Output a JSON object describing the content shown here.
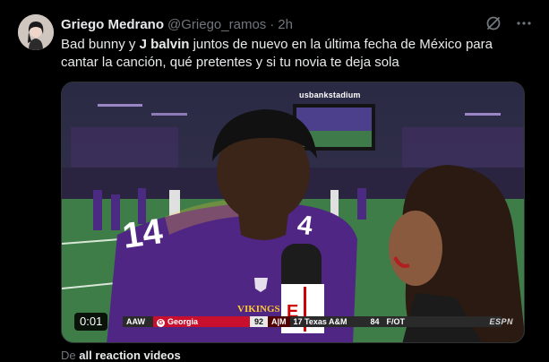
{
  "tweet": {
    "display_name": "Griego Medrano",
    "handle": "@Griego_ramos",
    "separator": "·",
    "time": "2h",
    "text_part1": "Bad bunny y ",
    "text_bold": "J balvin",
    "text_part2": " juntos de nuevo en la última fecha de México para cantar la canción, qué pretentes y si tu novia te deja sola"
  },
  "actions": {
    "grok_icon": "grok-icon",
    "more_icon": "more-options-icon"
  },
  "media": {
    "stadium_sign": "usbankstadium",
    "timestamp": "0:01",
    "ticker": {
      "left_text": "AAW",
      "team1": "Georgia",
      "team1_score": "92",
      "team2_logo": "A|M",
      "team2": "17 Texas A&M",
      "team2_score": "84",
      "status": "F/OT"
    },
    "broadcaster": "ESPN",
    "jersey_number": "14"
  },
  "source": {
    "prefix": "De",
    "link": "all reaction videos"
  },
  "colors": {
    "background": "#000000",
    "text": "#e7e9ea",
    "muted": "#71767b",
    "vikings_purple": "#4f2683",
    "georgia_red": "#c8102e",
    "tam_maroon": "#500000"
  }
}
